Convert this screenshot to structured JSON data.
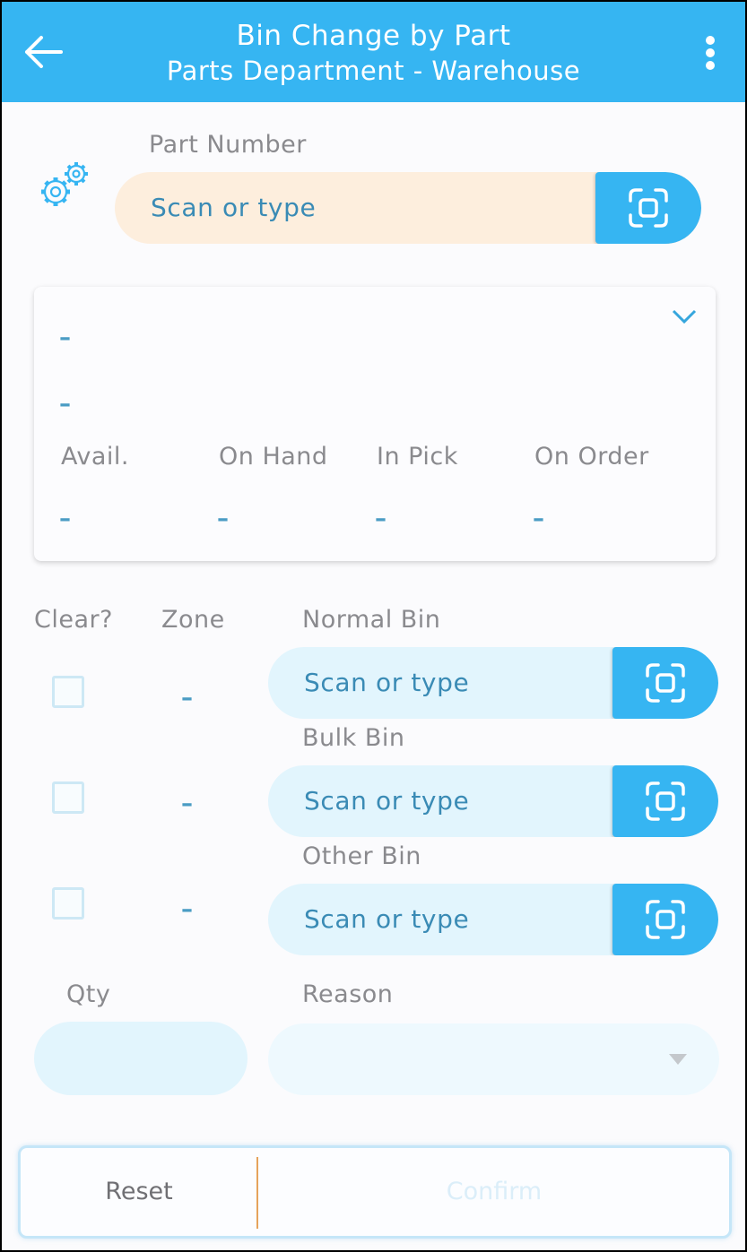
{
  "header": {
    "title": "Bin Change by Part",
    "subtitle": "Parts Department - Warehouse",
    "back_icon": "arrow-left-icon",
    "menu_icon": "more-vertical-icon"
  },
  "part_number": {
    "label": "Part Number",
    "placeholder": "Scan or type",
    "icon": "gears-icon",
    "scan_icon": "scan-frame-icon"
  },
  "part_card": {
    "line1": "–",
    "line2": "–",
    "expand_icon": "chevron-down-icon",
    "stats": [
      {
        "label": "Avail.",
        "value": "–"
      },
      {
        "label": "On Hand",
        "value": "–"
      },
      {
        "label": "In Pick",
        "value": "–"
      },
      {
        "label": "On Order",
        "value": "–"
      }
    ]
  },
  "bins": {
    "headers": {
      "clear": "Clear?",
      "zone": "Zone"
    },
    "rows": [
      {
        "label": "Normal Bin",
        "zone": "–",
        "placeholder": "Scan or type",
        "cleared": false
      },
      {
        "label": "Bulk Bin",
        "zone": "–",
        "placeholder": "Scan or type",
        "cleared": false
      },
      {
        "label": "Other Bin",
        "zone": "–",
        "placeholder": "Scan or type",
        "cleared": false
      }
    ]
  },
  "qty": {
    "label": "Qty",
    "value": ""
  },
  "reason": {
    "label": "Reason",
    "selected": ""
  },
  "footer": {
    "reset": "Reset",
    "confirm": "Confirm"
  },
  "colors": {
    "primary": "#36b5f2",
    "part_input_bg": "#fdeedd",
    "bin_input_bg": "#e2f5fd",
    "divider": "#e6a35c"
  }
}
